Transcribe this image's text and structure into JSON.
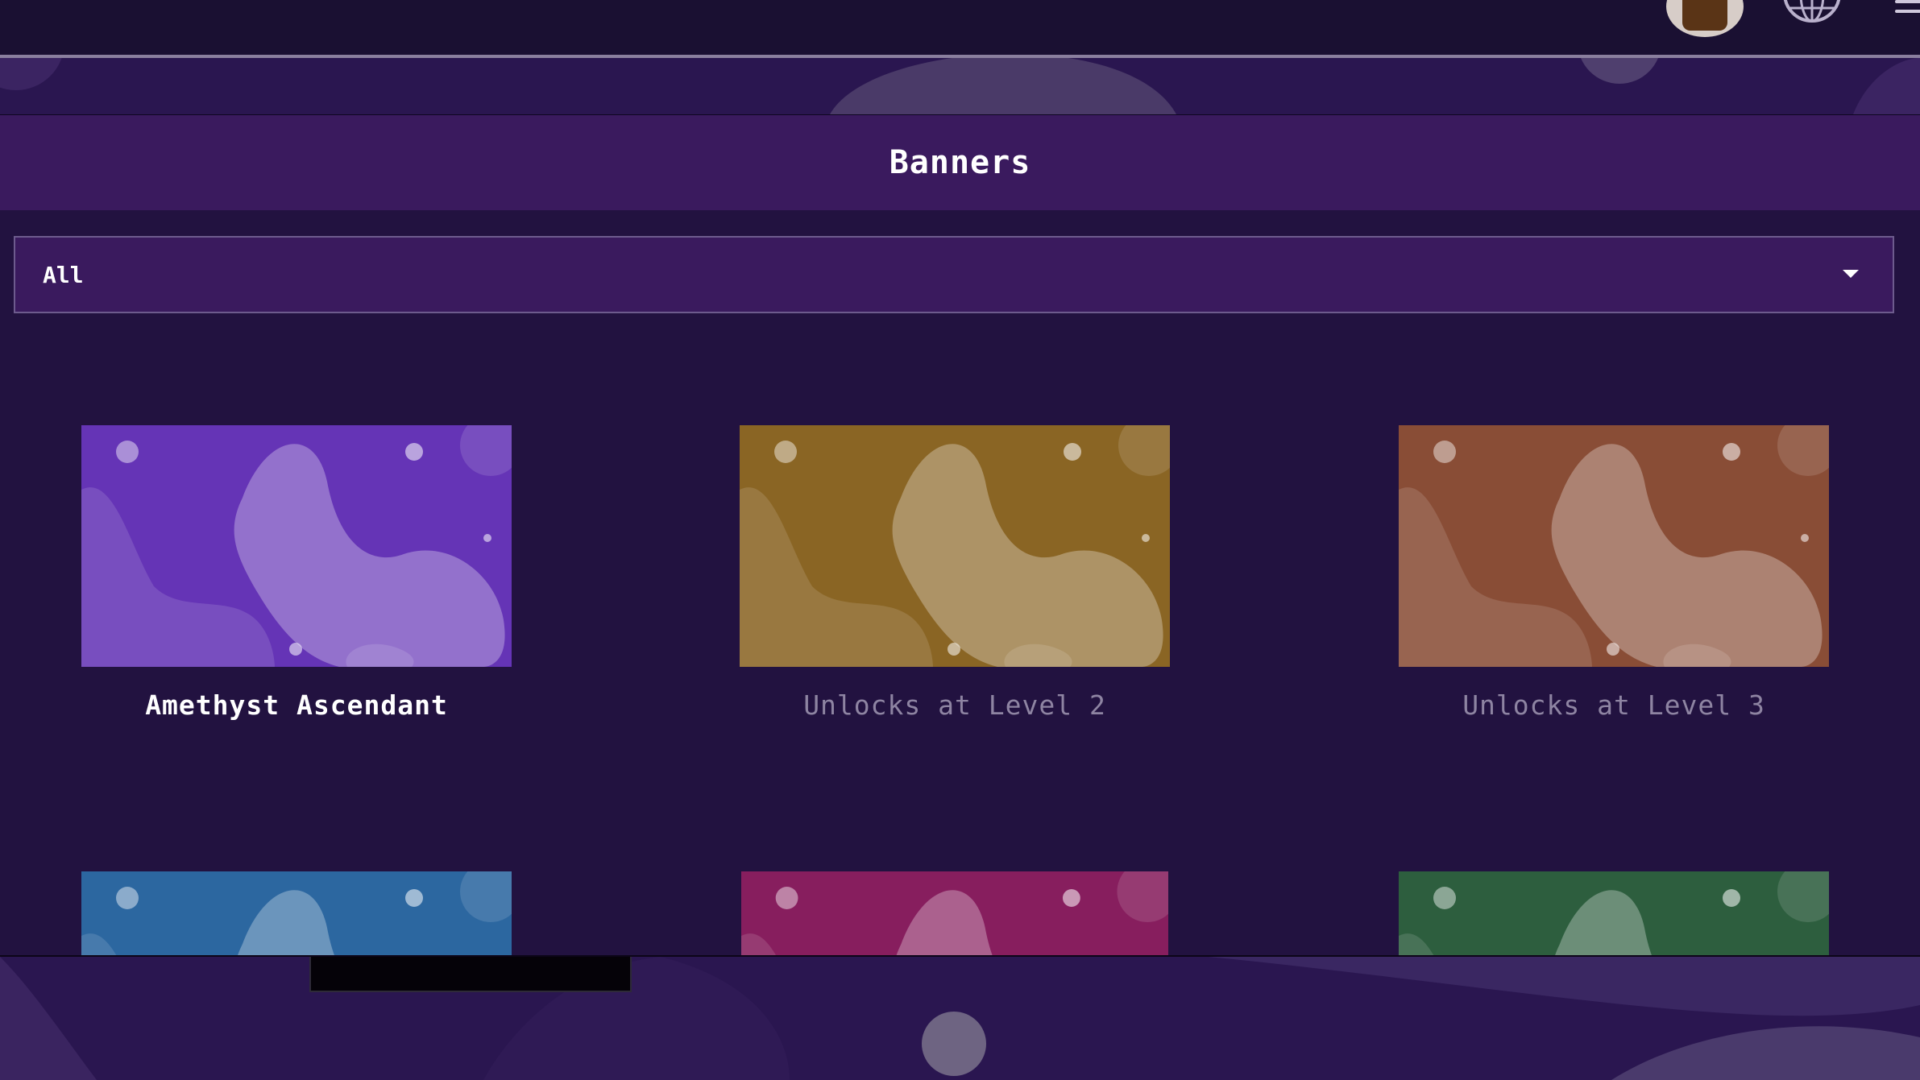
{
  "header": {
    "title": "Banners"
  },
  "filter": {
    "selected": "All"
  },
  "banners": [
    {
      "label": "Amethyst Ascendant",
      "color": "#6534b6",
      "locked": false
    },
    {
      "label": "Unlocks at Level 2",
      "color": "#8a6524",
      "locked": true
    },
    {
      "label": "Unlocks at Level 3",
      "color": "#894d36",
      "locked": true
    },
    {
      "label": "",
      "color": "#2c67a0",
      "locked": true
    },
    {
      "label": "",
      "color": "#871e5e",
      "locked": true
    },
    {
      "label": "",
      "color": "#2d5e3e",
      "locked": true
    }
  ],
  "icons": {
    "avatar": "avatar-icon",
    "language": "globe-icon",
    "menu": "hamburger-menu-icon",
    "dropdown": "chevron-down-icon"
  },
  "colors": {
    "background": "#221240",
    "header": "#3a1a5e",
    "topbar": "#1a1032",
    "locked_text": "#8e84a2"
  }
}
